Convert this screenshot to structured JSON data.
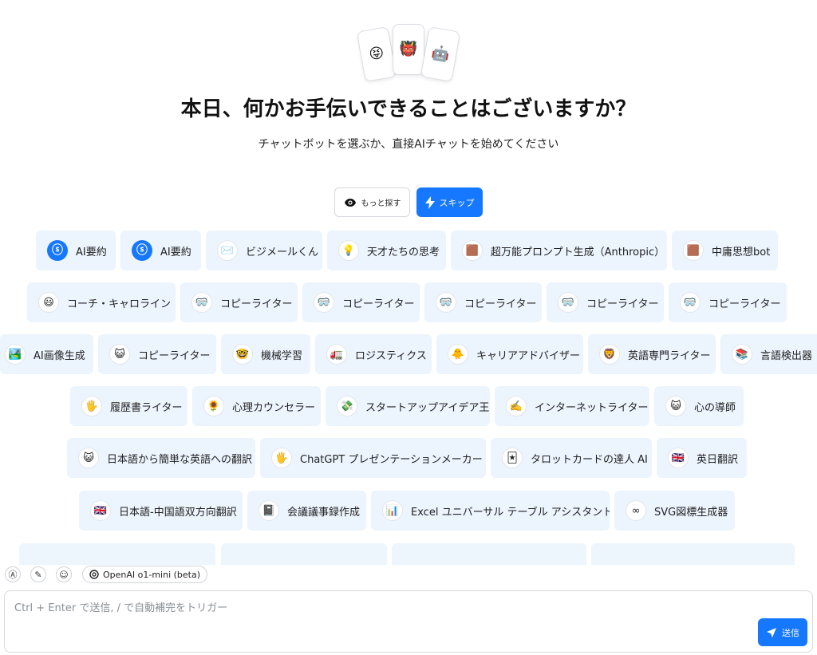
{
  "hero": {
    "emojis": [
      "😝",
      "👹",
      "🤖"
    ]
  },
  "title": "本日、何かお手伝いできることはございますか？",
  "subtitle": "チャットボットを選ぶか、直接AIチャットを始めてください",
  "buttons": {
    "explore_label": "もっと探す",
    "skip_label": "スキップ"
  },
  "chip_rows": [
    [
      {
        "label": "AI要約",
        "icon": "ⓢ",
        "icon_name": "ai-summary-logo-icon",
        "blue": true
      },
      {
        "label": "AI要約",
        "icon": "ⓢ",
        "icon_name": "ai-summary-logo-icon",
        "blue": true
      },
      {
        "label": "ビジメールくん",
        "icon": "✉️",
        "icon_name": "envelope-icon"
      },
      {
        "label": "天才たちの思考",
        "icon": "💡",
        "icon_name": "lightbulb-icon"
      },
      {
        "label": "超万能プロンプト生成（Anthropic）",
        "icon": "🟫",
        "icon_name": "anthropic-icon"
      },
      {
        "label": "中庸思想bot",
        "icon": "🟫",
        "icon_name": "anthropic-icon"
      }
    ],
    [
      {
        "label": "コーチ・キャロライン",
        "icon": "😃",
        "icon_name": "smile-face-icon"
      },
      {
        "label": "コピーライター",
        "icon": "🥽",
        "icon_name": "goggles-icon"
      },
      {
        "label": "コピーライター",
        "icon": "🥽",
        "icon_name": "goggles-icon"
      },
      {
        "label": "コピーライター",
        "icon": "🥽",
        "icon_name": "goggles-icon"
      },
      {
        "label": "コピーライター",
        "icon": "🥽",
        "icon_name": "goggles-icon"
      },
      {
        "label": "コピーライター",
        "icon": "🥽",
        "icon_name": "goggles-icon"
      }
    ],
    [
      {
        "label": "AI画像生成",
        "icon": "🏞️",
        "icon_name": "landscape-icon"
      },
      {
        "label": "コピーライター",
        "icon": "😺",
        "icon_name": "cat-face-icon"
      },
      {
        "label": "機械学習",
        "icon": "🤓",
        "icon_name": "nerd-face-icon"
      },
      {
        "label": "ロジスティクス",
        "icon": "🚛",
        "icon_name": "truck-icon"
      },
      {
        "label": "キャリアアドバイザー",
        "icon": "🐥",
        "icon_name": "chick-icon"
      },
      {
        "label": "英語専門ライター",
        "icon": "🦁",
        "icon_name": "lion-icon"
      },
      {
        "label": "言語検出器",
        "icon": "📚",
        "icon_name": "books-icon"
      }
    ],
    [
      {
        "label": "履歴書ライター",
        "icon": "🖐️",
        "icon_name": "hand-icon"
      },
      {
        "label": "心理カウンセラー",
        "icon": "🌻",
        "icon_name": "sunflower-icon"
      },
      {
        "label": "スタートアップアイデア王",
        "icon": "💸",
        "icon_name": "money-icon"
      },
      {
        "label": "インターネットライター",
        "icon": "✍️",
        "icon_name": "writing-hand-icon"
      },
      {
        "label": "心の導師",
        "icon": "😺",
        "icon_name": "cat-face-icon"
      }
    ],
    [
      {
        "label": "日本語から簡単な英語への翻訳",
        "icon": "😺",
        "icon_name": "cat-face-icon"
      },
      {
        "label": "ChatGPT プレゼンテーションメーカー",
        "icon": "🖐️",
        "icon_name": "hand-icon"
      },
      {
        "label": "タロットカードの達人 AI",
        "icon": "🃏",
        "icon_name": "tarot-card-icon"
      },
      {
        "label": "英日翻訳",
        "icon": "🇬🇧",
        "icon_name": "uk-flag-icon"
      }
    ],
    [
      {
        "label": "日本語-中国語双方向翻訳",
        "icon": "🇬🇧",
        "icon_name": "uk-flag-icon"
      },
      {
        "label": "会議議事録作成",
        "icon": "📓",
        "icon_name": "notebook-icon"
      },
      {
        "label": "Excel ユニバーサル テーブル アシスタント",
        "icon": "📊",
        "icon_name": "bar-chart-icon"
      },
      {
        "label": "SVG図標生成器",
        "icon": "∞",
        "icon_name": "infinity-icon"
      }
    ]
  ],
  "toolbar": {
    "tool_icons": [
      "Ⓐ",
      "✎",
      "☺"
    ],
    "model_label": "OpenAI o1-mini (beta)"
  },
  "composer": {
    "placeholder": "Ctrl + Enter で送信, / で自動補完をトリガー",
    "send_label": "送信"
  }
}
